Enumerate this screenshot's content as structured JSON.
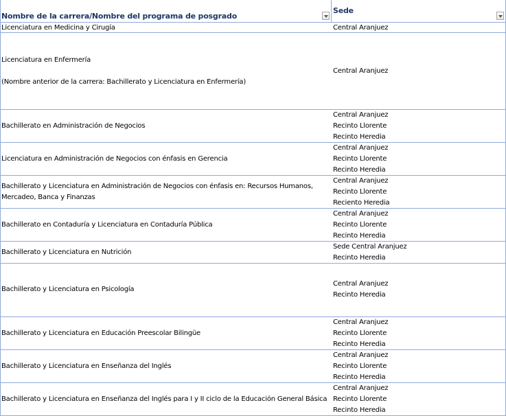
{
  "header": {
    "col1": "Nombre de la carrera/Nombre del programa de posgrado",
    "col2": "Sede"
  },
  "rows": [
    {
      "career": [
        "Licenciatura en Medicina y Cirugía"
      ],
      "sites": [
        "Central Aranjuez"
      ]
    },
    {
      "career": [
        " Licenciatura en Enfermería",
        "(Nombre anterior de la carrera: Bachillerato y Licenciatura en Enfermería)"
      ],
      "sites": [
        "Central Aranjuez"
      ]
    },
    {
      "career": [
        "Bachillerato en Administración de Negocios"
      ],
      "sites": [
        "Central Aranjuez",
        "Recinto Llorente",
        "Recinto Heredia"
      ]
    },
    {
      "career": [
        "Licenciatura en Administración de Negocios con énfasis en Gerencia"
      ],
      "sites": [
        "Central Aranjuez",
        "Recinto Llorente",
        "Recinto Heredia"
      ]
    },
    {
      "career": [
        "Bachillerato y Licenciatura en Administración de Negocios con énfasis en: Recursos Humanos,",
        "Mercadeo, Banca y Finanzas"
      ],
      "sites": [
        "Central Aranjuez",
        "Recinto Llorente",
        "Reciento Heredia"
      ]
    },
    {
      "career": [
        "Bachillerato  en Contaduría y Licenciatura en Contaduría Pública"
      ],
      "sites": [
        "Central Aranjuez",
        "Recinto Llorente",
        "Recinto Heredia"
      ]
    },
    {
      "career": [
        "Bachillerato y Licenciatura en Nutrición"
      ],
      "sites": [
        "Sede Central Aranjuez",
        "Recinto Heredia"
      ]
    },
    {
      "career": [
        "Bachillerato y Licenciatura  en Psicología"
      ],
      "sites": [
        "Central Aranjuez",
        "Recinto Heredia"
      ]
    },
    {
      "career": [
        "Bachillerato y Licenciatura en Educación Preescolar Bilingüe"
      ],
      "sites": [
        "Central Aranjuez",
        "Recinto Llorente",
        "Recinto Heredia"
      ]
    },
    {
      "career": [
        "Bachillerato y Licenciatura en Enseñanza del Inglés"
      ],
      "sites": [
        "Central Aranjuez",
        "Recinto Llorente",
        "Recinto Heredia"
      ]
    },
    {
      "career": [
        "Bachillerato y Licenciatura en Enseñanza del Inglés para I y II ciclo de la Educación General Básica"
      ],
      "sites": [
        "Central Aranjuez",
        "Recinto Llorente",
        "Recinto Heredia"
      ]
    }
  ]
}
